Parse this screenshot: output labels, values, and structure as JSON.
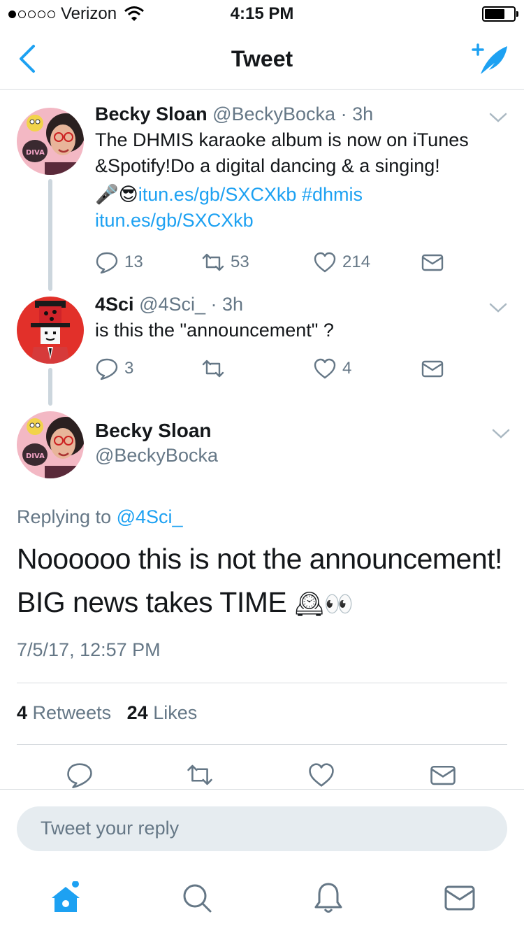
{
  "status_bar": {
    "carrier": "Verizon",
    "time": "4:15 PM"
  },
  "nav": {
    "title": "Tweet"
  },
  "thread": [
    {
      "name": "Becky Sloan",
      "handle": "@BeckyBocka",
      "time": "· 3h",
      "text": "The DHMIS karaoke album is now on iTunes &Spotify!Do a digital dancing & a singing!",
      "emoji": "🎤😎",
      "link1": "itun.es/gb/SXCXkb",
      "hashtag": "#dhmis",
      "link2": "itun.es/gb/SXCXkb",
      "replies": "13",
      "retweets": "53",
      "likes": "214"
    },
    {
      "name": "4Sci",
      "handle": "@4Sci_",
      "time": "· 3h",
      "text": "is this the \"announcement\" ?",
      "replies": "3",
      "retweets": "",
      "likes": "4"
    }
  ],
  "main_tweet": {
    "name": "Becky Sloan",
    "handle": "@BeckyBocka",
    "replying_prefix": "Replying to",
    "replying_to": "@4Sci_",
    "text_line1": "Noooooo this is not the announcement!",
    "text_line2": "BIG news takes TIME",
    "text_emoji": "🕰👀",
    "timestamp": "7/5/17, 12:57 PM",
    "retweet_count": "4",
    "retweet_label": "Retweets",
    "like_count": "24",
    "like_label": "Likes"
  },
  "reply": {
    "placeholder": "Tweet your reply"
  },
  "colors": {
    "accent": "#1da1f2",
    "secondary_text": "#657786",
    "divider": "#d7dbdf"
  },
  "icons": [
    "back-chevron-icon",
    "compose-tweet-icon",
    "reply-icon",
    "retweet-icon",
    "like-icon",
    "direct-message-icon",
    "home-icon",
    "search-icon",
    "notifications-icon",
    "messages-icon"
  ]
}
